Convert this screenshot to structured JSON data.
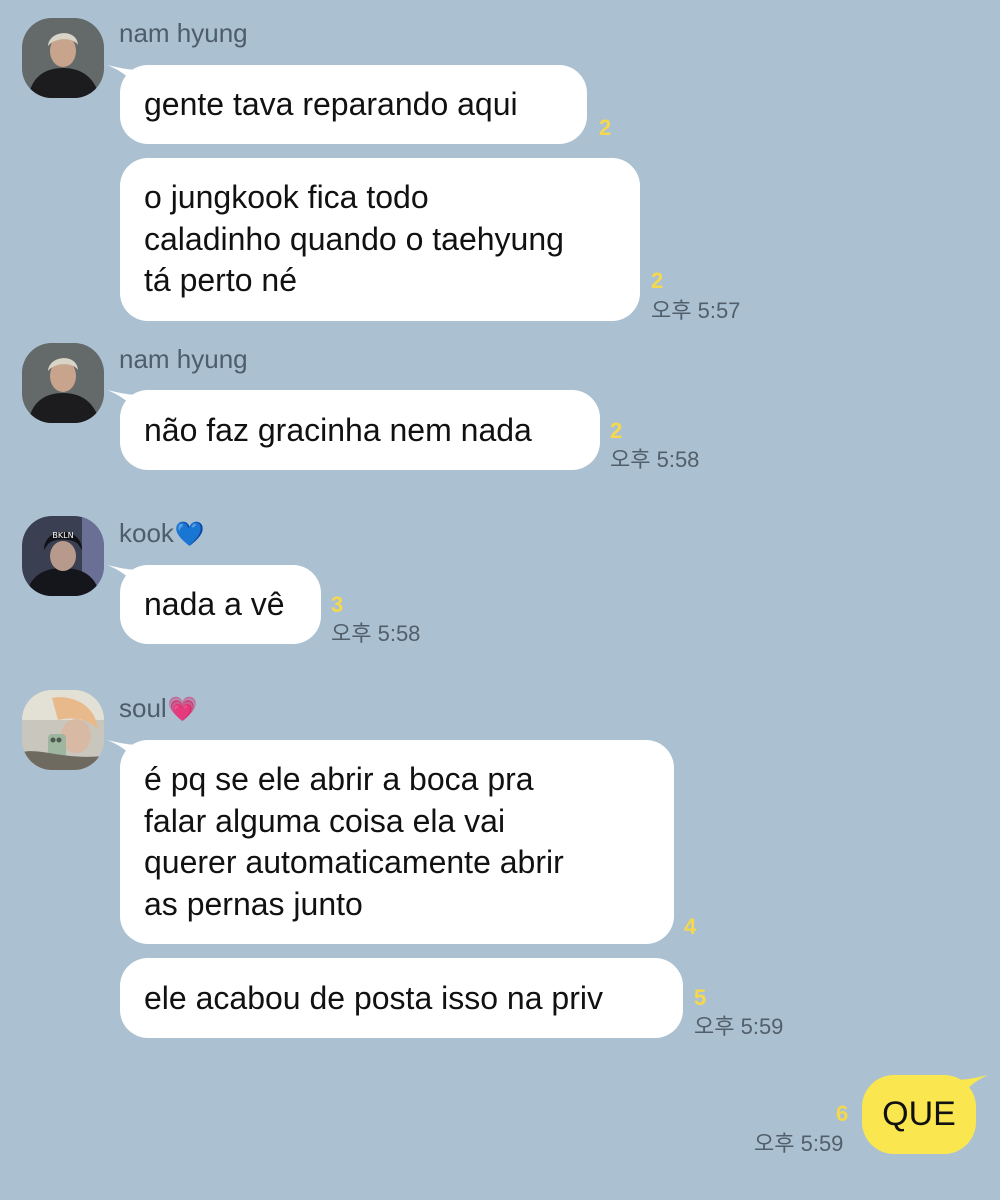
{
  "messages": [
    {
      "sender": "nam hyung",
      "text": "gente tava reparando aqui",
      "unread": "2"
    },
    {
      "text": "o jungkook fica todo\ncaladinho quando o taehyung\ntá perto né",
      "unread": "2",
      "time": "오후 5:57"
    },
    {
      "sender": "nam hyung",
      "text": "não faz gracinha nem nada",
      "unread": "2",
      "time": "오후 5:58"
    },
    {
      "sender": "kook",
      "sender_emoji": "💙",
      "text": "nada a vê",
      "unread": "3",
      "time": "오후 5:58"
    },
    {
      "sender": "soul",
      "sender_emoji": "💗",
      "text": "é pq se ele abrir a boca pra\nfalar alguma coisa ela vai\nquerer automaticamente abrir\nas pernas junto",
      "unread": "4"
    },
    {
      "text": "ele acabou de posta isso na priv",
      "unread": "5",
      "time": "오후 5:59"
    }
  ],
  "my_message": {
    "text": "QUE",
    "unread": "6",
    "time": "오후 5:59"
  },
  "colors": {
    "background": "#abc1d1",
    "incoming_bubble": "#ffffff",
    "outgoing_bubble": "#fae64f",
    "unread_count": "#f5d84c"
  }
}
